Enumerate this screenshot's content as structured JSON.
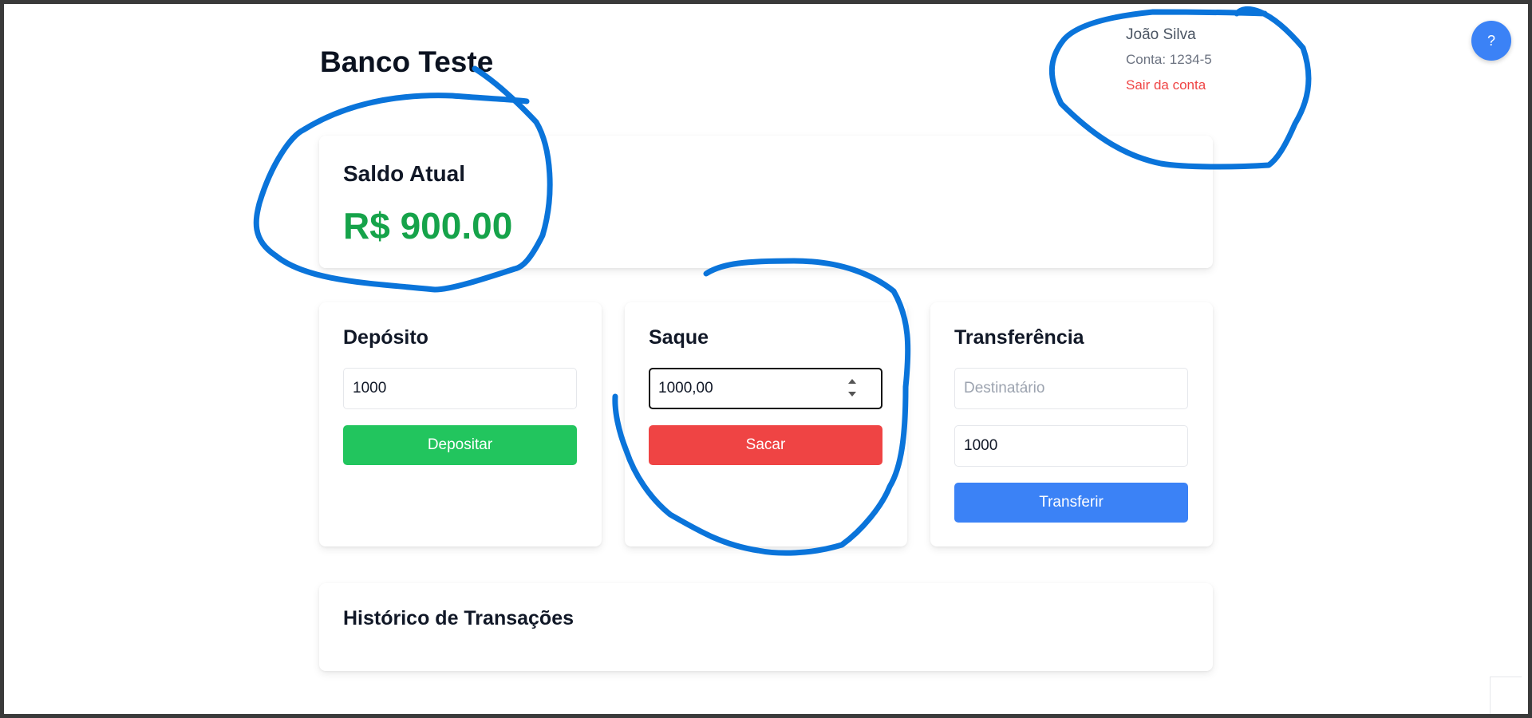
{
  "header": {
    "title": "Banco Teste"
  },
  "user": {
    "name": "João Silva",
    "account": "Conta: 1234-5",
    "logout_label": "Sair da conta"
  },
  "help": {
    "label": "?"
  },
  "balance": {
    "label": "Saldo Atual",
    "value": "R$ 900.00"
  },
  "deposit": {
    "title": "Depósito",
    "amount_value": "1000",
    "button_label": "Depositar"
  },
  "withdraw": {
    "title": "Saque",
    "amount_value": "1000,00",
    "button_label": "Sacar"
  },
  "transfer": {
    "title": "Transferência",
    "recipient_placeholder": "Destinatário",
    "amount_value": "1000",
    "button_label": "Transferir"
  },
  "history": {
    "title": "Histórico de Transações"
  },
  "colors": {
    "balance_positive": "#16a34a",
    "deposit_button": "#22c55e",
    "withdraw_button": "#ef4444",
    "transfer_button": "#3b82f6",
    "logout_link": "#ef4444",
    "annotation_stroke": "#0a74da"
  },
  "icons": {
    "help": "question-mark-icon",
    "spinner_up": "spinner-up-icon",
    "spinner_down": "spinner-down-icon"
  }
}
